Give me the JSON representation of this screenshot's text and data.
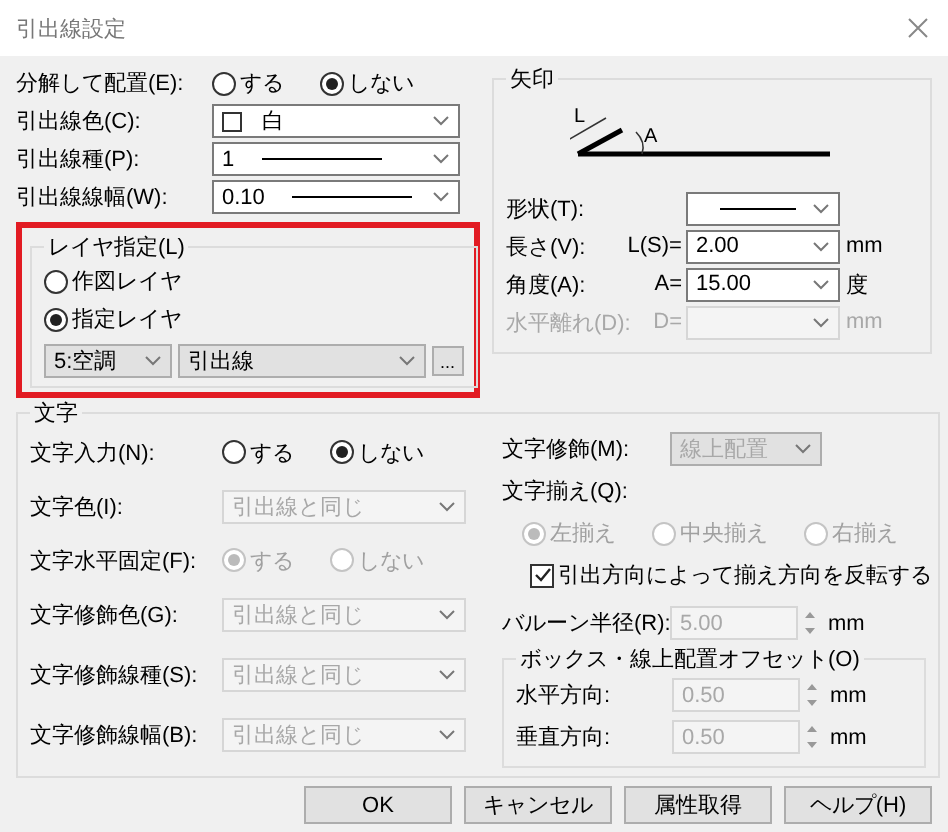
{
  "window": {
    "title": "引出線設定"
  },
  "placement": {
    "label": "分解して配置(E):",
    "options": [
      {
        "label": "する",
        "selected": false
      },
      {
        "label": "しない",
        "selected": true
      }
    ]
  },
  "line_fields": [
    {
      "kind": "color",
      "label": "引出線色(C):",
      "value": "白"
    },
    {
      "kind": "line",
      "label": "引出線種(P):",
      "value": "1"
    },
    {
      "kind": "line",
      "label": "引出線線幅(W):",
      "value": "0.10"
    }
  ],
  "layer": {
    "title": "レイヤ指定(L)",
    "highlighted": true,
    "options": [
      {
        "label": "作図レイヤ",
        "selected": false
      },
      {
        "label": "指定レイヤ",
        "selected": true
      }
    ],
    "group": "5:空調",
    "layer": "引出線",
    "browse": "..."
  },
  "arrow": {
    "title": "矢印",
    "diagram_labels": [
      "L",
      "A"
    ],
    "fields": [
      {
        "kind": "shape",
        "label": "形状(T):",
        "disabled": false
      },
      {
        "kind": "value",
        "label": "長さ(V):",
        "prefix": "L(S)=",
        "value": "2.00",
        "unit": "mm",
        "disabled": false
      },
      {
        "kind": "value",
        "label": "角度(A):",
        "prefix": "A=",
        "value": "15.00",
        "unit": "度",
        "disabled": false
      },
      {
        "kind": "value",
        "label": "水平離れ(D):",
        "prefix": "D=",
        "unit": "mm",
        "disabled": true
      }
    ]
  },
  "text": {
    "title": "文字",
    "left_rows": [
      {
        "kind": "radio",
        "label": "文字入力(N):",
        "disabled": false,
        "options": [
          {
            "label": "する",
            "selected": false
          },
          {
            "label": "しない",
            "selected": true
          }
        ]
      },
      {
        "kind": "dropdown",
        "label": "文字色(I):",
        "value": "引出線と同じ",
        "disabled": true
      },
      {
        "kind": "radio",
        "label": "文字水平固定(F):",
        "disabled": true,
        "options": [
          {
            "label": "する",
            "selected": true
          },
          {
            "label": "しない",
            "selected": false
          }
        ]
      },
      {
        "kind": "dropdown",
        "label": "文字修飾色(G):",
        "value": "引出線と同じ",
        "disabled": true
      },
      {
        "kind": "dropdown",
        "label": "文字修飾線種(S):",
        "value": "引出線と同じ",
        "disabled": true
      },
      {
        "kind": "dropdown",
        "label": "文字修飾線幅(B):",
        "value": "引出線と同じ",
        "disabled": true
      }
    ],
    "decoration": {
      "label": "文字修飾(M):",
      "value": "線上配置",
      "disabled": true
    },
    "align": {
      "label": "文字揃え(Q):",
      "disabled": true,
      "options": [
        {
          "label": "左揃え",
          "selected": true
        },
        {
          "label": "中央揃え",
          "selected": false
        },
        {
          "label": "右揃え",
          "selected": false
        }
      ]
    },
    "reverse": {
      "label": "引出方向によって揃え方向を反転する",
      "checked": true
    },
    "balloon": {
      "label": "バルーン半径(R):",
      "value": "5.00",
      "unit": "mm",
      "disabled": true
    },
    "offset": {
      "title": "ボックス・線上配置オフセット(O)",
      "fields": [
        {
          "label": "水平方向:",
          "value": "0.50",
          "unit": "mm",
          "disabled": true
        },
        {
          "label": "垂直方向:",
          "value": "0.50",
          "unit": "mm",
          "disabled": true
        }
      ]
    }
  },
  "buttons": [
    "OK",
    "キャンセル",
    "属性取得",
    "ヘルプ(H)"
  ]
}
